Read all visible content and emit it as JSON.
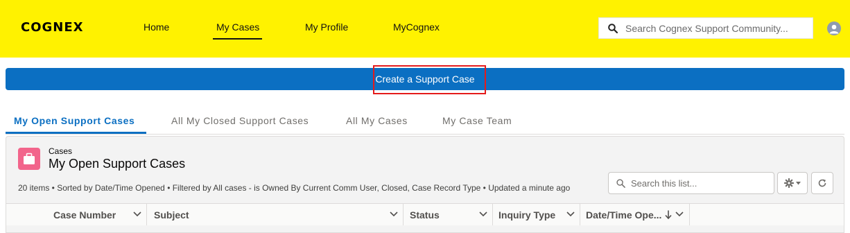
{
  "header": {
    "logo_text": "COGNEX",
    "nav": [
      {
        "label": "Home"
      },
      {
        "label": "My Cases",
        "active": true
      },
      {
        "label": "My Profile"
      },
      {
        "label": "MyCognex"
      }
    ],
    "search_placeholder": "Search Cognex Support Community...",
    "accent_color": "#fff200"
  },
  "create_button": {
    "label": "Create a Support Case",
    "color": "#0b6fc2"
  },
  "tabs": [
    {
      "label": "My Open Support Cases",
      "active": true
    },
    {
      "label": "All My Closed Support Cases"
    },
    {
      "label": "All My Cases"
    },
    {
      "label": "My Case Team"
    }
  ],
  "list_view": {
    "object_label": "Cases",
    "title": "My Open Support Cases",
    "info": "20 items • Sorted by Date/Time Opened • Filtered by All cases - is Owned By Current Comm User, Closed, Case Record Type • Updated a minute ago",
    "search_placeholder": "Search this list...",
    "icon": "briefcase-icon",
    "icon_color": "#f2648b",
    "columns": [
      {
        "label": "Case Number"
      },
      {
        "label": "Subject"
      },
      {
        "label": "Status"
      },
      {
        "label": "Inquiry Type"
      },
      {
        "label": "Date/Time Ope...",
        "sorted": "descending"
      }
    ]
  }
}
